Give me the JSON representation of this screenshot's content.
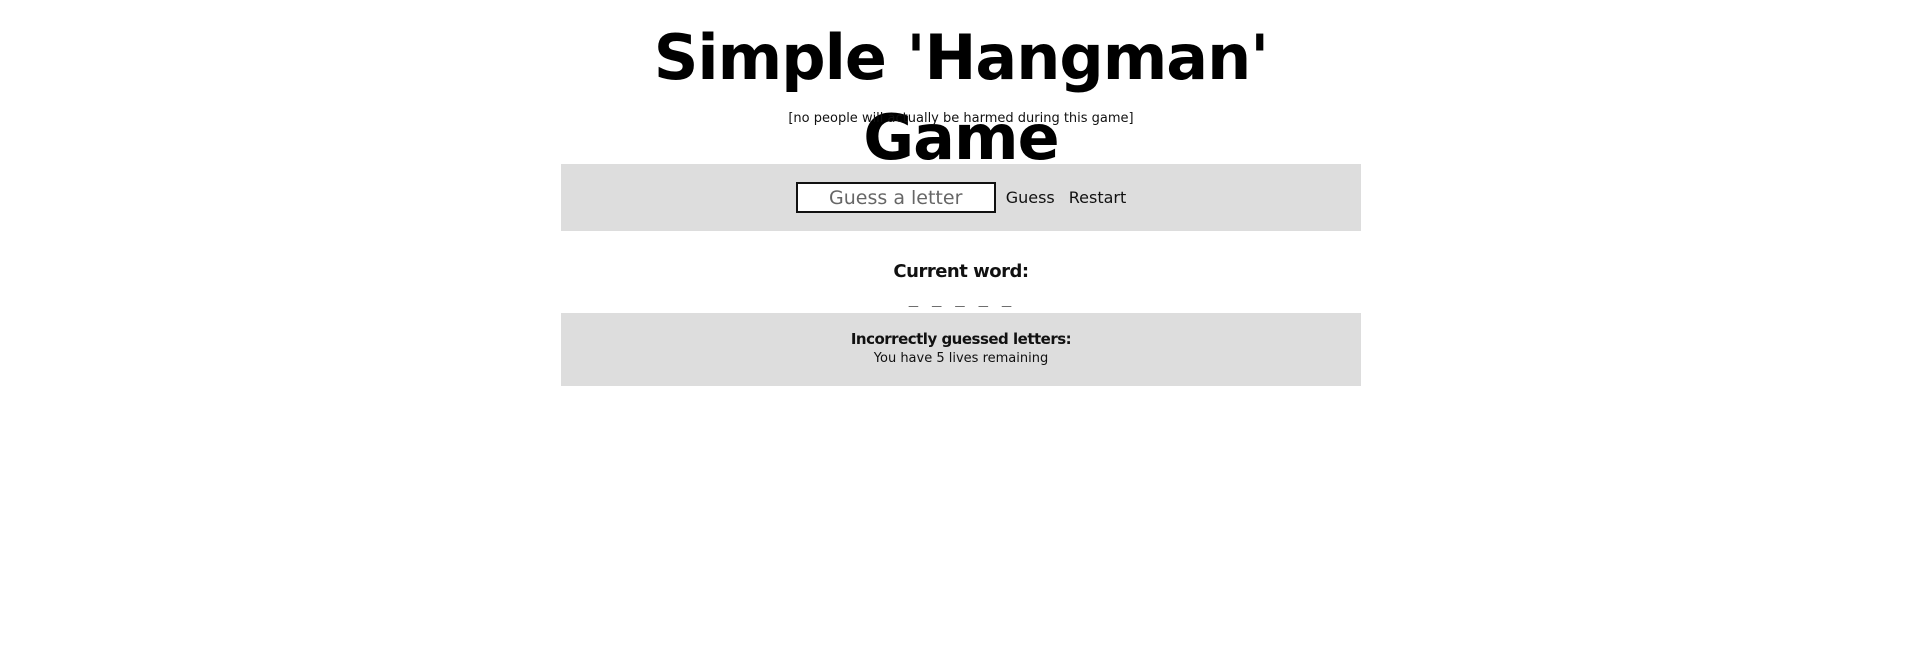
{
  "header": {
    "title": "Simple 'Hangman' Game",
    "subtitle": "[no people will actually be harmed during this game]"
  },
  "guess_form": {
    "input_value": "",
    "input_placeholder": "Guess a letter",
    "guess_label": "Guess",
    "restart_label": "Restart"
  },
  "current_word": {
    "label": "Current word:",
    "value": "_ _ _ _ _"
  },
  "incorrect": {
    "label": "Incorrectly guessed letters:",
    "letters": "",
    "lives_text": "You have 5 lives remaining"
  },
  "colors": {
    "panel_background": "#dddddd",
    "text": "#111111",
    "page_background": "#ffffff"
  }
}
